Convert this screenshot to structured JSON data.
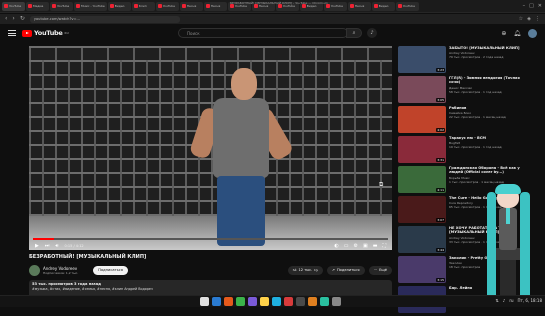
{
  "browser": {
    "window_title": "БЕЗРАБОТНЫЙ! [МУЗЫКАЛЬНЫЙ КЛИП] - YouTube — Chromium",
    "tabs": [
      {
        "label": "YouTube",
        "color": "#e53935"
      },
      {
        "label": "Медиа",
        "color": "#e53935"
      },
      {
        "label": "YouTube",
        "color": "#e53935"
      },
      {
        "label": "Music - YouTube",
        "color": "#e53935"
      },
      {
        "label": "Видео",
        "color": "#e53935"
      },
      {
        "label": "Клип",
        "color": "#e53935"
      },
      {
        "label": "YouTube",
        "color": "#e53935"
      },
      {
        "label": "Песня",
        "color": "#e53935"
      },
      {
        "label": "Песня",
        "color": "#e53935"
      },
      {
        "label": "YouTube",
        "color": "#e53935"
      },
      {
        "label": "Песня",
        "color": "#e53935"
      },
      {
        "label": "YouTube",
        "color": "#e53935"
      },
      {
        "label": "Видео",
        "color": "#e53935"
      },
      {
        "label": "YouTube",
        "color": "#e53935"
      },
      {
        "label": "Песня",
        "color": "#e53935"
      },
      {
        "label": "Видео",
        "color": "#e53935"
      },
      {
        "label": "YouTube",
        "color": "#e53935"
      }
    ],
    "url": "youtube.com/watch?v=...",
    "brand_color": "#ff0000"
  },
  "youtube": {
    "logo_text": "YouTube",
    "logo_sup": "RU",
    "search_placeholder": "Поиск"
  },
  "player": {
    "time": "0:15 / 4:12",
    "progress_played_pct": 6,
    "progress_buffered_pct": 20
  },
  "video": {
    "title": "БЕЗРАБОТНЫЙ! [МУЗЫКАЛЬНЫЙ КЛИП]",
    "channel": "Andrey Vodoreev",
    "subscribers": "Подписчиков: 1,2 тыс.",
    "subscribe_label": "Подписаться",
    "likes": "12 тыс.",
    "share_label": "Поделиться",
    "more_label": "Ещё",
    "stats": "53 тыс. просмотров  3 года назад",
    "description": "#музыка, #стих, #видение, #семья, #песня, #клип Андрей Водорез"
  },
  "recommendations": [
    {
      "title": "ЗАБЫТО! [МУЗЫКАЛЬНЫЙ КЛИП]",
      "channel": "Andrey Vodoreev",
      "meta": "79 тыс. просмотров · 2 года назад",
      "duration": "3:23",
      "color": "#3a4d6a"
    },
    {
      "title": "ГГЛ(R) - Зимняя вендигия (Точная сочи)",
      "channel": "Денис Максим",
      "meta": "58 тыс. просмотров · 1 год назад",
      "duration": "3:05",
      "color": "#7a4a5a"
    },
    {
      "title": "Рабинов",
      "channel": "Семейка Боко",
      "meta": "22 тыс. просмотров · 1 месяц назад",
      "duration": "4:02",
      "color": "#c0432a"
    },
    {
      "title": "Таракус ню - ВСМ",
      "channel": "BugTalt",
      "meta": "19 тыс. просмотров · 1 год назад",
      "duration": "3:31",
      "color": "#8a2a3a"
    },
    {
      "title": "Гражданская Оборона - Всё как у людей (Official cover by...)",
      "channel": "Борьба Music",
      "meta": "1 тыс. просмотров · 1 месяц назад",
      "duration": "4:11",
      "color": "#3a6a3a"
    },
    {
      "title": "The Cure - Hello Goodbye",
      "channel": "Cure Repository",
      "meta": "65 тыс. просмотров · 1 год назад",
      "duration": "3:07",
      "color": "#4a1a1a"
    },
    {
      "title": "НЕ ХОЧУ РАБОТАТЬ НА ТОЁ! [МУЗЫКАЛЬНЫЙ КЛИП]",
      "channel": "Andrey Vodoreev",
      "meta": "33 тыс. просмотров · 1 год назад",
      "duration": "3:44",
      "color": "#2a3a4a"
    },
    {
      "title": "Заколик - Pretty One",
      "channel": "Заколик",
      "meta": "18 тыс. просмотров",
      "duration": "3:15",
      "color": "#4a3a6a"
    },
    {
      "title": "Бар. Лейно",
      "channel": "",
      "meta": "",
      "duration": "",
      "color": "#2a2a5a"
    }
  ],
  "taskbar": {
    "dock_colors": [
      "#e0e0e0",
      "#2a7bd1",
      "#e55a1c",
      "#3bb34a",
      "#7a5ad8",
      "#ffd24a",
      "#1fb0e0",
      "#d83b3b",
      "#4a4a4a",
      "#e08020",
      "#2ac0a0",
      "#888888"
    ],
    "lang": "ru",
    "clock": "Пт, 6, 18:18"
  },
  "decor": {
    "miku_hair": "#3cc2c2"
  }
}
